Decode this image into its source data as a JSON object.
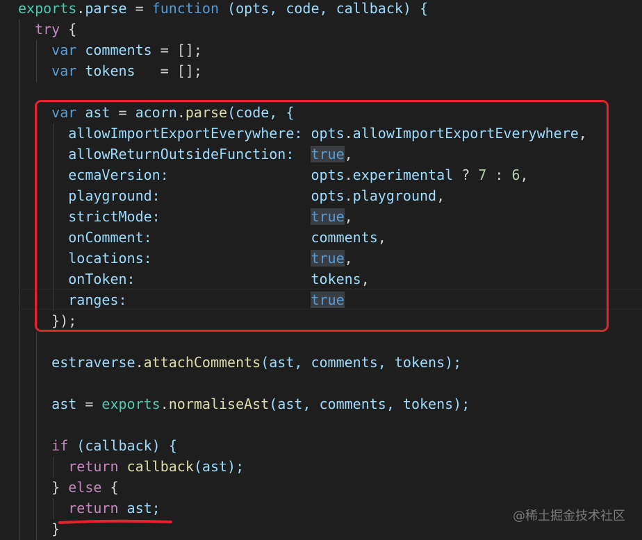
{
  "code": {
    "exports": "exports",
    "parse": "parse",
    "eq": " = ",
    "function_kw": "function",
    "params": " (opts, code, callback) {",
    "try_kw": "try",
    "try_brace": " {",
    "var_kw": "var",
    "comments": "comments",
    "comments_init": " = [];",
    "tokens": "tokens",
    "tokens_init": "   = [];",
    "ast": "ast",
    "acorn": "acorn",
    "open_call": "(code, {",
    "dot": ".",
    "comma": ",",
    "true": "true",
    "opts": "opts",
    "k1": "allowImportExportEverywhere:",
    "v1": "allowImportExportEverywhere",
    "k2": "allowReturnOutsideFunction:",
    "k3": "ecmaVersion:",
    "v3a": "experimental",
    "v3b": " ? ",
    "n7": "7",
    "colon": " : ",
    "n6": "6",
    "k4": "playground:",
    "v4": "playground",
    "k5": "strictMode:",
    "k6": "onComment:",
    "k7": "locations:",
    "k8": "onToken:",
    "k9": "ranges:",
    "close_obj": "});",
    "estraverse": "estraverse",
    "attachComments": "attachComments",
    "attach_args": "(ast, comments, tokens);",
    "normaliseAst": "normaliseAst",
    "if_kw": "if",
    "if_cond": " (callback) {",
    "return_kw": "return",
    "callback": "callback",
    "cb_args": "(ast);",
    "else_open": "} ",
    "else_kw": "else",
    "else_close": " {",
    "ast_semi": "ast;",
    "close_brace": "}"
  },
  "watermark": "@稀土掘金技术社区",
  "colors": {
    "background": "#1e1e1e",
    "keyword": "#569cd6",
    "control": "#c586c0",
    "function": "#dcdcaa",
    "variable": "#9cdcfe",
    "class": "#4ec9b0",
    "number": "#b5cea8",
    "annotation": "#e8212e"
  }
}
